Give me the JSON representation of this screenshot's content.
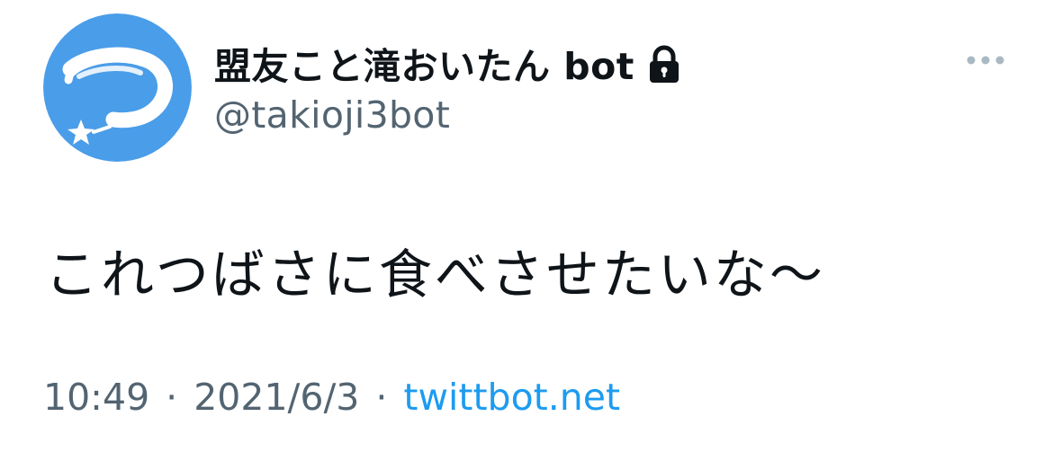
{
  "user": {
    "display_name": "盟友こと滝おいたん bot",
    "username": "@takioji3bot",
    "protected": true,
    "lock_icon": "lock-icon",
    "avatar_icon": "shooting-star-logo-icon",
    "avatar_color": "#4a9de8"
  },
  "tweet": {
    "text": "これつばさに食べさせたいな〜",
    "time": "10:49",
    "date": "2021/6/3",
    "source": "twittbot.net",
    "separator": "·"
  },
  "actions": {
    "more_icon": "more-horizontal-icon"
  },
  "colors": {
    "text_primary": "#0f1419",
    "text_secondary": "#536471",
    "link": "#1d9bf0",
    "more_dots": "#aab8c2",
    "background": "#ffffff"
  }
}
